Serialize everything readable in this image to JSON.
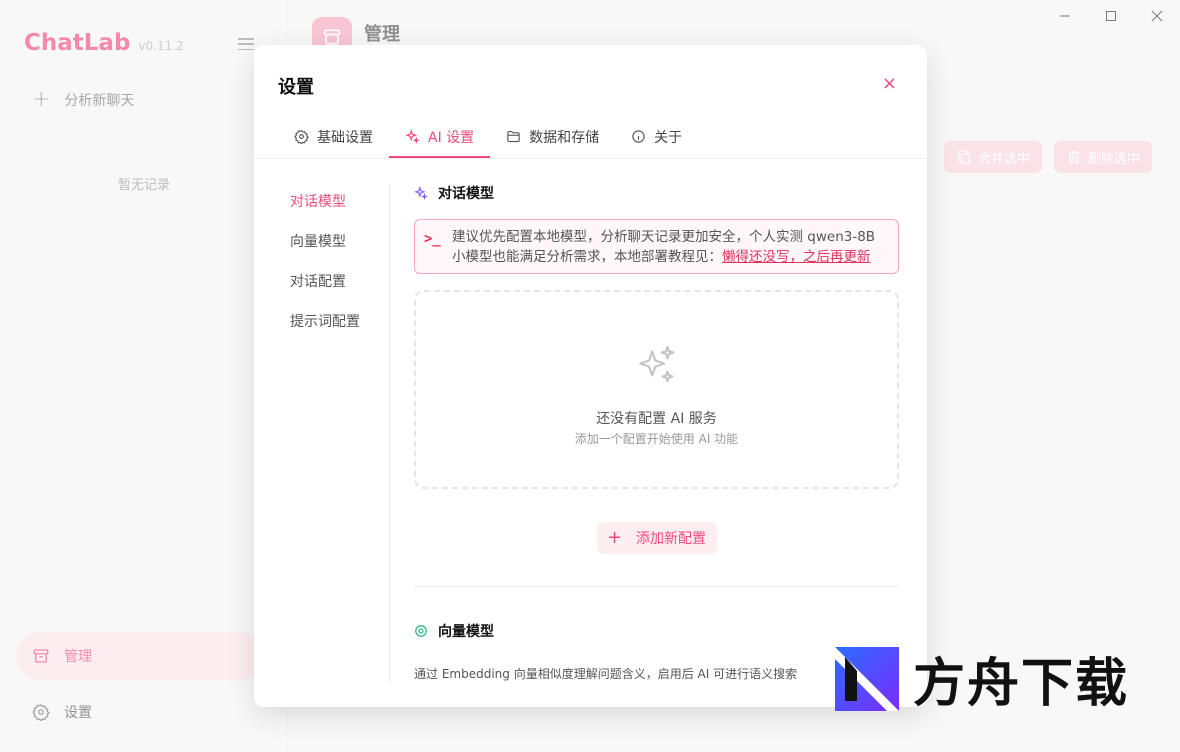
{
  "app": {
    "brand": "ChatLab",
    "version": "v0.11.2",
    "new_chat_label": "分析新聊天",
    "empty_history": "暂无记录",
    "bottom_nav": [
      {
        "label": "管理",
        "active": true
      },
      {
        "label": "设置",
        "active": false
      }
    ],
    "main_title": "管理",
    "merge_label": "合并选中",
    "delete_label": "删除选中"
  },
  "modal": {
    "title": "设置",
    "close_glyph": "×",
    "tabs": [
      {
        "label": "基础设置",
        "icon": "gear-icon",
        "active": false
      },
      {
        "label": "AI 设置",
        "icon": "sparkles-icon",
        "active": true
      },
      {
        "label": "数据和存储",
        "icon": "folder-icon",
        "active": false
      },
      {
        "label": "关于",
        "icon": "info-icon",
        "active": false
      }
    ],
    "subnav": [
      {
        "label": "对话模型",
        "active": true
      },
      {
        "label": "向量模型",
        "active": false
      },
      {
        "label": "对话配置",
        "active": false
      },
      {
        "label": "提示词配置",
        "active": false
      }
    ],
    "section_chat_model": "对话模型",
    "notice": {
      "prompt_glyph": ">_",
      "text_line1": "建议优先配置本地模型，分析聊天记录更加安全，个人实测 qwen3-8B",
      "text_line2": "小模型也能满足分析需求，本地部署教程见：",
      "link": "懒得还没写，之后再更新"
    },
    "empty_title": "还没有配置 AI 服务",
    "empty_subtitle": "添加一个配置开始使用 AI 功能",
    "add_button": "添加新配置",
    "section_vector_model": "向量模型",
    "vector_desc": "通过 Embedding 向量相似度理解问题含义，启用后 AI 可进行语义搜索"
  },
  "watermark": {
    "text": "方舟下载"
  },
  "colors": {
    "accent": "#ee4b7c",
    "accent_soft": "#fdeef2",
    "notice_border": "#f3a7bd",
    "vector_icon": "#22b07d",
    "sparkle_icon": "#8b5cf6"
  }
}
